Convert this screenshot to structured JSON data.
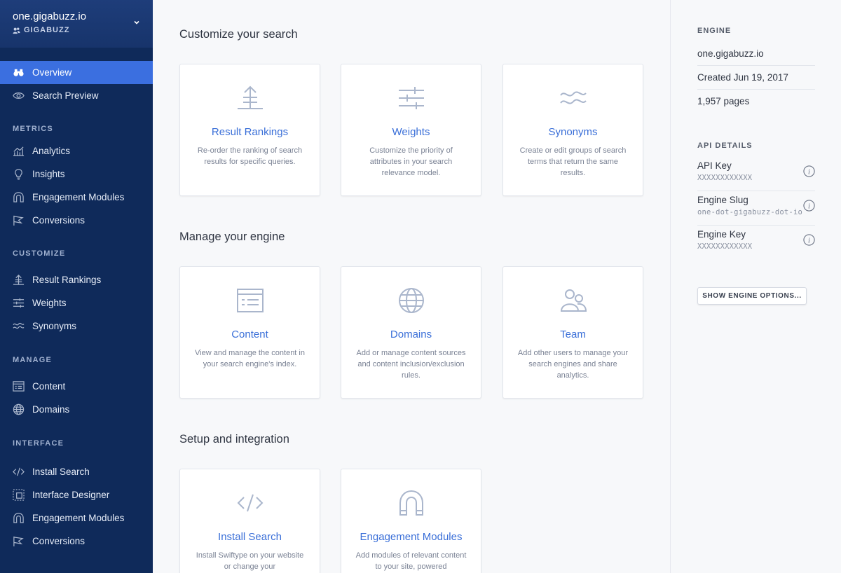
{
  "account": {
    "name": "one.gigabuzz.io",
    "org": "GIGABUZZ"
  },
  "sidebar": {
    "overview": "Overview",
    "search_preview": "Search Preview",
    "metrics": {
      "heading": "METRICS",
      "items": [
        "Analytics",
        "Insights",
        "Engagement Modules",
        "Conversions"
      ]
    },
    "customize": {
      "heading": "CUSTOMIZE",
      "items": [
        "Result Rankings",
        "Weights",
        "Synonyms"
      ]
    },
    "manage": {
      "heading": "MANAGE",
      "items": [
        "Content",
        "Domains"
      ]
    },
    "interface": {
      "heading": "INTERFACE",
      "items": [
        "Install Search",
        "Interface Designer",
        "Engagement Modules",
        "Conversions"
      ]
    }
  },
  "main": {
    "customize": {
      "title": "Customize your search",
      "cards": [
        {
          "title": "Result Rankings",
          "desc": "Re-order the ranking of search results for specific queries."
        },
        {
          "title": "Weights",
          "desc": "Customize the priority of attributes in your search relevance model."
        },
        {
          "title": "Synonyms",
          "desc": "Create or edit groups of search terms that return the same results."
        }
      ]
    },
    "manage": {
      "title": "Manage your engine",
      "cards": [
        {
          "title": "Content",
          "desc": "View and manage the content in your search engine's index."
        },
        {
          "title": "Domains",
          "desc": "Add or manage content sources and content inclusion/exclusion rules."
        },
        {
          "title": "Team",
          "desc": "Add other users to manage your search engines and share analytics."
        }
      ]
    },
    "setup": {
      "title": "Setup and integration",
      "cards": [
        {
          "title": "Install Search",
          "desc": "Install Swiftype on your website or change your"
        },
        {
          "title": "Engagement Modules",
          "desc": "Add modules of relevant content to your site, powered"
        }
      ]
    }
  },
  "engine": {
    "heading": "ENGINE",
    "name": "one.gigabuzz.io",
    "created": "Created Jun 19, 2017",
    "pages": "1,957 pages"
  },
  "api": {
    "heading": "API DETAILS",
    "rows": [
      {
        "label": "API Key",
        "value": "XXXXXXXXXXXX"
      },
      {
        "label": "Engine Slug",
        "value": "one-dot-gigabuzz-dot-io"
      },
      {
        "label": "Engine Key",
        "value": "XXXXXXXXXXXX"
      }
    ],
    "options_button": "SHOW ENGINE OPTIONS..."
  },
  "colors": {
    "sidebar": "#0f2a5a",
    "active": "#3b6fe0",
    "link": "#3a6fd8",
    "icon": "#aab6cc"
  }
}
